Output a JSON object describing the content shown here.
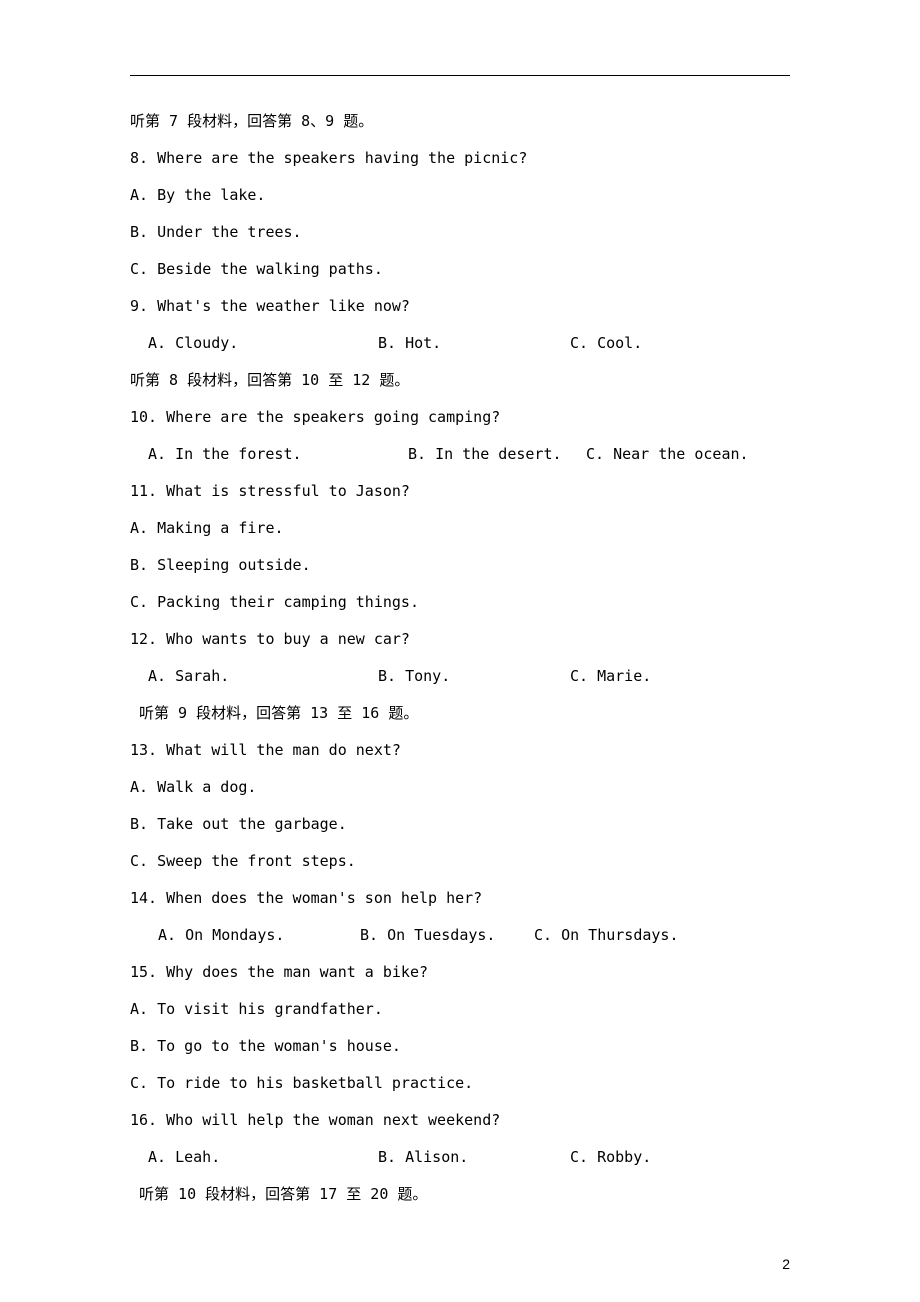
{
  "page_number": "2",
  "sections": {
    "s7": {
      "header": "听第 7 段材料，回答第 8、9 题。",
      "q8": {
        "stem": "8. Where are the speakers having the picnic?",
        "a": "A. By the lake.",
        "b": "B. Under the trees.",
        "c": "C. Beside the walking paths."
      },
      "q9": {
        "stem": "9. What's the weather like now?",
        "a": "A. Cloudy.",
        "b": "B. Hot.",
        "c": "C. Cool."
      }
    },
    "s8": {
      "header": "听第 8 段材料，回答第 10 至 12 题。",
      "q10": {
        "stem": "10. Where are the speakers going camping?",
        "a": "A. In the forest.",
        "b": "B. In the desert.",
        "c": "C. Near the ocean."
      },
      "q11": {
        "stem": "11. What is stressful to Jason?",
        "a": "A. Making a fire.",
        "b": "B. Sleeping outside.",
        "c": "C. Packing their camping things."
      },
      "q12": {
        "stem": "12. Who wants to buy a new car?",
        "a": "A. Sarah.",
        "b": "B. Tony.",
        "c": "C. Marie."
      }
    },
    "s9": {
      "header": " 听第 9 段材料，回答第 13 至 16 题。",
      "q13": {
        "stem": "13. What will the man do next?",
        "a": "A. Walk a dog.",
        "b": "B. Take out the garbage.",
        "c": "C. Sweep the front steps."
      },
      "q14": {
        "stem": "14. When does the woman's son help her?",
        "a": "A. On Mondays.",
        "b": "B. On Tuesdays.",
        "c": "C. On Thursdays."
      },
      "q15": {
        "stem": "15. Why does the man want a bike?",
        "a": "A. To visit his grandfather.",
        "b": "B. To go to the woman's house.",
        "c": "C. To ride to his basketball practice."
      },
      "q16": {
        "stem": "16. Who will help the woman next weekend?",
        "a": "A. Leah.",
        "b": "B. Alison.",
        "c": "C. Robby."
      }
    },
    "s10": {
      "header": " 听第 10 段材料，回答第 17 至 20 题。"
    }
  }
}
